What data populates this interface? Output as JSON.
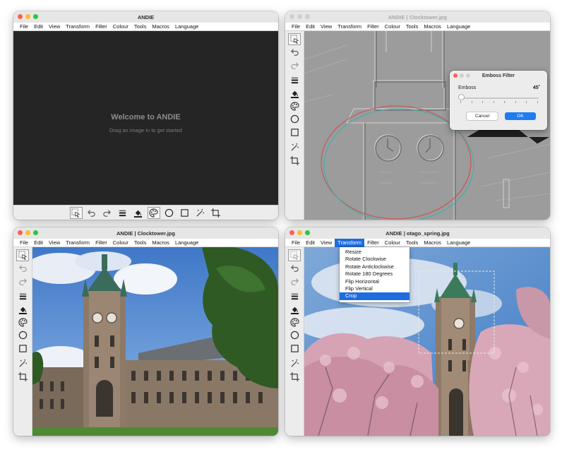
{
  "menus": [
    "File",
    "Edit",
    "View",
    "Transform",
    "Filter",
    "Colour",
    "Tools",
    "Macros",
    "Language"
  ],
  "windows": {
    "w1": {
      "title": "ANDIE"
    },
    "w2": {
      "title": "ANDIE | Clocktower.jpg"
    },
    "w3": {
      "title": "ANDIE | Clocktower.jpg"
    },
    "w4": {
      "title": "ANDIE | otago_spring.jpg"
    }
  },
  "welcome": {
    "title": "Welcome to ANDIE",
    "subtitle": "Drag an image in to get started"
  },
  "emboss_dialog": {
    "title": "Emboss Filter",
    "label": "Emboss",
    "value": "45˚",
    "slider_fraction": 0.0,
    "cancel_label": "Cancel",
    "ok_label": "OK"
  },
  "transform_menu": {
    "items": [
      "Resize",
      "Rotate Clockwise",
      "Rotate Anticlockwise",
      "Rotate 180 Degrees",
      "Flip Horizontal",
      "Flip Vertical",
      "Crop"
    ],
    "highlighted_index": 6
  },
  "tools": [
    "select-tool-icon",
    "undo-icon",
    "redo-icon",
    "line-weight-icon",
    "fill-colour-icon",
    "palette-icon",
    "circle-tool-icon",
    "rectangle-tool-icon",
    "magic-wand-icon",
    "crop-icon"
  ],
  "colors": {
    "accent": "#1f6ce0",
    "ok_button": "#1f7cf0",
    "dark_canvas": "#252525"
  }
}
